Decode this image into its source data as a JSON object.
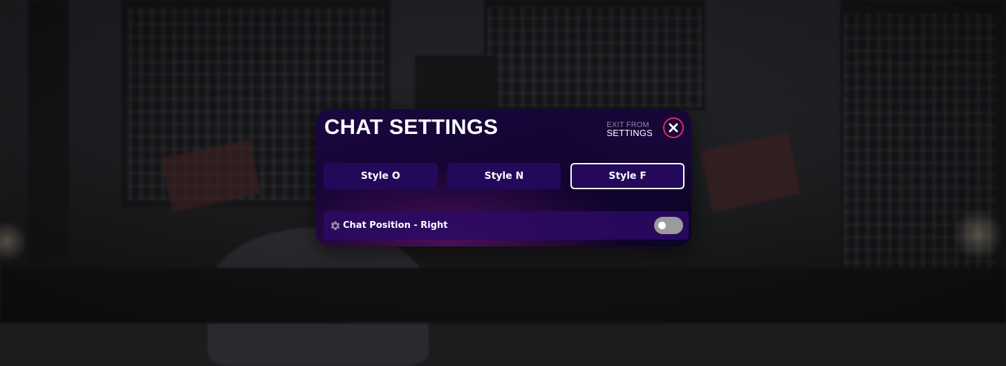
{
  "panel": {
    "title": "CHAT SETTINGS",
    "exit": {
      "line1": "EXIT FROM",
      "line2": "SETTINGS",
      "close_icon": "close-icon"
    }
  },
  "styles": {
    "options": [
      {
        "label": "Style O",
        "active": false
      },
      {
        "label": "Style N",
        "active": false
      },
      {
        "label": "Style F",
        "active": true
      }
    ]
  },
  "settings": {
    "chat_position": {
      "icon": "gear-icon",
      "label": "Chat Position - Right",
      "enabled": false
    }
  },
  "colors": {
    "accent_close": "#e3304b",
    "button_bg": "#24095a",
    "toggle_off": "#9a9a9f"
  }
}
